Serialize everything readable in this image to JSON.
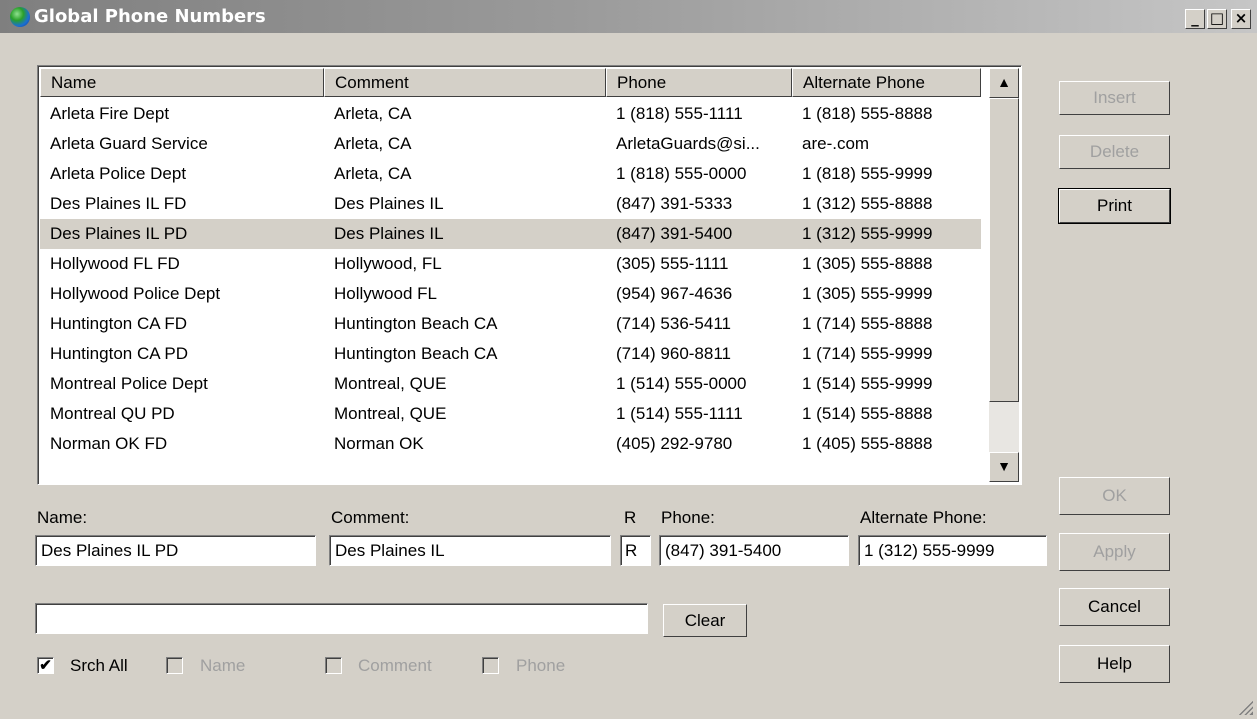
{
  "window": {
    "title": "Global Phone Numbers",
    "min_label": "_",
    "max_label": "□",
    "close_label": "×"
  },
  "list": {
    "columns": [
      "Name",
      "Comment",
      "Phone",
      "Alternate Phone"
    ],
    "selected_index": 4,
    "rows": [
      [
        "Arleta Fire Dept",
        "Arleta, CA",
        "1 (818) 555-1111",
        "1 (818) 555-8888"
      ],
      [
        "Arleta Guard Service",
        "Arleta, CA",
        "ArletaGuards@si...",
        "are-.com"
      ],
      [
        "Arleta Police Dept",
        "Arleta, CA",
        "1 (818) 555-0000",
        "1 (818) 555-9999"
      ],
      [
        "Des Plaines IL FD",
        "Des Plaines IL",
        "(847) 391-5333",
        "1 (312) 555-8888"
      ],
      [
        "Des Plaines IL PD",
        "Des Plaines IL",
        "(847) 391-5400",
        "1 (312) 555-9999"
      ],
      [
        "Hollywood FL FD",
        "Hollywood, FL",
        "(305) 555-1111",
        "1 (305) 555-8888"
      ],
      [
        "Hollywood Police Dept",
        "Hollywood FL",
        "(954) 967-4636",
        "1 (305) 555-9999"
      ],
      [
        "Huntington CA FD",
        "Huntington Beach CA",
        "(714) 536-5411",
        "1 (714) 555-8888"
      ],
      [
        "Huntington CA PD",
        "Huntington Beach CA",
        "(714) 960-8811",
        "1 (714) 555-9999"
      ],
      [
        "Montreal Police Dept",
        "Montreal, QUE",
        "1 (514) 555-0000",
        "1 (514) 555-9999"
      ],
      [
        "Montreal QU PD",
        "Montreal, QUE",
        "1 (514) 555-1111",
        "1 (514) 555-8888"
      ],
      [
        "Norman OK FD",
        "Norman OK",
        "(405) 292-9780",
        "1 (405) 555-8888"
      ]
    ],
    "scroll_up_icon": "▲",
    "scroll_down_icon": "▼"
  },
  "form": {
    "name_label": "Name:",
    "comment_label": "Comment:",
    "r_label": "R",
    "phone_label": "Phone:",
    "alt_phone_label": "Alternate Phone:",
    "name_value": "Des Plaines IL PD",
    "comment_value": "Des Plaines IL",
    "r_value": "R",
    "phone_value": "(847) 391-5400",
    "alt_phone_value": "1 (312) 555-9999"
  },
  "search": {
    "value": "",
    "clear_label": "Clear",
    "srch_all_label": "Srch All",
    "srch_all_checked": "✔",
    "name_label": "Name",
    "comment_label": "Comment",
    "phone_label": "Phone"
  },
  "buttons": {
    "insert": "Insert",
    "delete": "Delete",
    "print": "Print",
    "ok": "OK",
    "apply": "Apply",
    "cancel": "Cancel",
    "help": "Help"
  }
}
